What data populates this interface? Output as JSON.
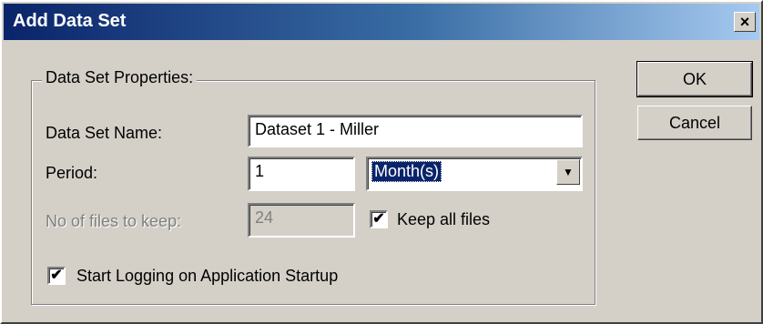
{
  "dialog": {
    "title": "Add Data Set",
    "close_icon": "close-icon",
    "close_glyph": "×"
  },
  "group": {
    "label": "Data Set Properties:"
  },
  "fields": {
    "name_label": "Data Set Name:",
    "name_value": "Dataset 1 - Miller",
    "period_label": "Period:",
    "period_value": "1",
    "period_unit": "Month(s)",
    "dropdown_glyph": "▼",
    "files_label": "No of files to keep:",
    "files_value": "24",
    "keep_all_label": "Keep all files",
    "keep_all_checked": true,
    "startup_label": "Start Logging on Application Startup",
    "startup_checked": true,
    "check_glyph": "✔"
  },
  "buttons": {
    "ok": "OK",
    "cancel": "Cancel"
  }
}
